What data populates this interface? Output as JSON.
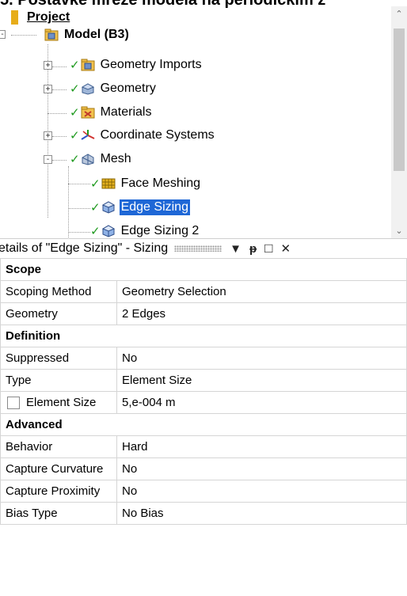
{
  "caption": "5. Postavke mreže modela na periodičkim z",
  "tree": {
    "root": "Project",
    "model": "Model (B3)",
    "items": [
      {
        "label": "Geometry Imports",
        "icon": "folder-import-icon"
      },
      {
        "label": "Geometry",
        "icon": "geometry-icon"
      },
      {
        "label": "Materials",
        "icon": "materials-icon"
      },
      {
        "label": "Coordinate Systems",
        "icon": "coordinate-systems-icon"
      },
      {
        "label": "Mesh",
        "icon": "mesh-icon"
      },
      {
        "label": "Face Meshing",
        "icon": "face-meshing-icon"
      },
      {
        "label": "Edge Sizing",
        "icon": "edge-sizing-icon",
        "selected": true
      },
      {
        "label": "Edge Sizing 2",
        "icon": "edge-sizing-icon"
      }
    ]
  },
  "details": {
    "title": "etails of \"Edge Sizing\" - Sizing",
    "buttons": {
      "dropdown": "▼",
      "pin": "ᵽ",
      "maximize": "□",
      "close": "✕"
    },
    "sections": {
      "scope": "Scope",
      "definition": "Definition",
      "advanced": "Advanced"
    },
    "rows": {
      "scoping_method": {
        "label": "Scoping Method",
        "value": "Geometry Selection"
      },
      "geometry": {
        "label": "Geometry",
        "value": "2 Edges"
      },
      "suppressed": {
        "label": "Suppressed",
        "value": "No"
      },
      "type": {
        "label": "Type",
        "value": "Element Size"
      },
      "element_size": {
        "label": "Element Size",
        "value": "5,e-004 m"
      },
      "behavior": {
        "label": "Behavior",
        "value": "Hard"
      },
      "capture_curvature": {
        "label": "Capture Curvature",
        "value": "No"
      },
      "capture_proximity": {
        "label": "Capture Proximity",
        "value": "No"
      },
      "bias_type": {
        "label": "Bias Type",
        "value": "No Bias"
      }
    }
  },
  "colors": {
    "selection": "#1e67d6",
    "check": "#1f9a1f"
  }
}
